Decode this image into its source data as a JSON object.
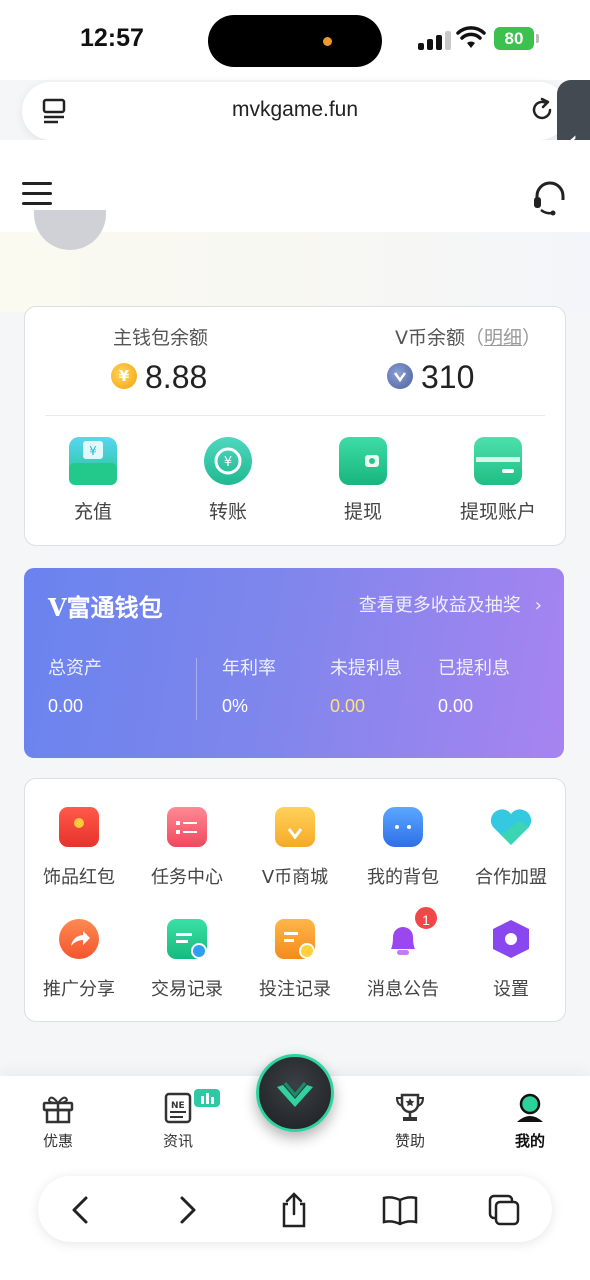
{
  "status_bar": {
    "time": "12:57",
    "battery": "80"
  },
  "browser": {
    "url": "mvkgame.fun"
  },
  "wallet": {
    "main_label": "主钱包余额",
    "main_value": "8.88",
    "coin_symbol": "¥",
    "vcoin_label": "V币余额",
    "vcoin_detail_open": "（",
    "vcoin_detail": "明细",
    "vcoin_detail_close": "）",
    "vcoin_value": "310",
    "actions": [
      {
        "label": "充值"
      },
      {
        "label": "转账"
      },
      {
        "label": "提现"
      },
      {
        "label": "提现账户"
      }
    ]
  },
  "vfu": {
    "title": "V富通钱包",
    "more": "查看更多收益及抽奖",
    "stats": [
      {
        "label": "总资产",
        "value": "0.00"
      },
      {
        "label": "年利率",
        "value": "0%"
      },
      {
        "label": "未提利息",
        "value": "0.00"
      },
      {
        "label": "已提利息",
        "value": "0.00"
      }
    ]
  },
  "grid": {
    "items": [
      {
        "label": "饰品红包"
      },
      {
        "label": "任务中心"
      },
      {
        "label": "V币商城"
      },
      {
        "label": "我的背包"
      },
      {
        "label": "合作加盟"
      },
      {
        "label": "推广分享"
      },
      {
        "label": "交易记录"
      },
      {
        "label": "投注记录"
      },
      {
        "label": "消息公告",
        "badge": "1"
      },
      {
        "label": "设置"
      }
    ]
  },
  "bottom_nav": {
    "items": [
      {
        "label": "优惠"
      },
      {
        "label": "资讯"
      },
      {
        "label": "赞助"
      },
      {
        "label": "我的"
      }
    ]
  },
  "colors": {
    "accent_green": "#2fd39e",
    "card_gradient_start": "#6a83ee",
    "card_gradient_end": "#a784f0",
    "highlight_yellow": "#ffe27a"
  }
}
